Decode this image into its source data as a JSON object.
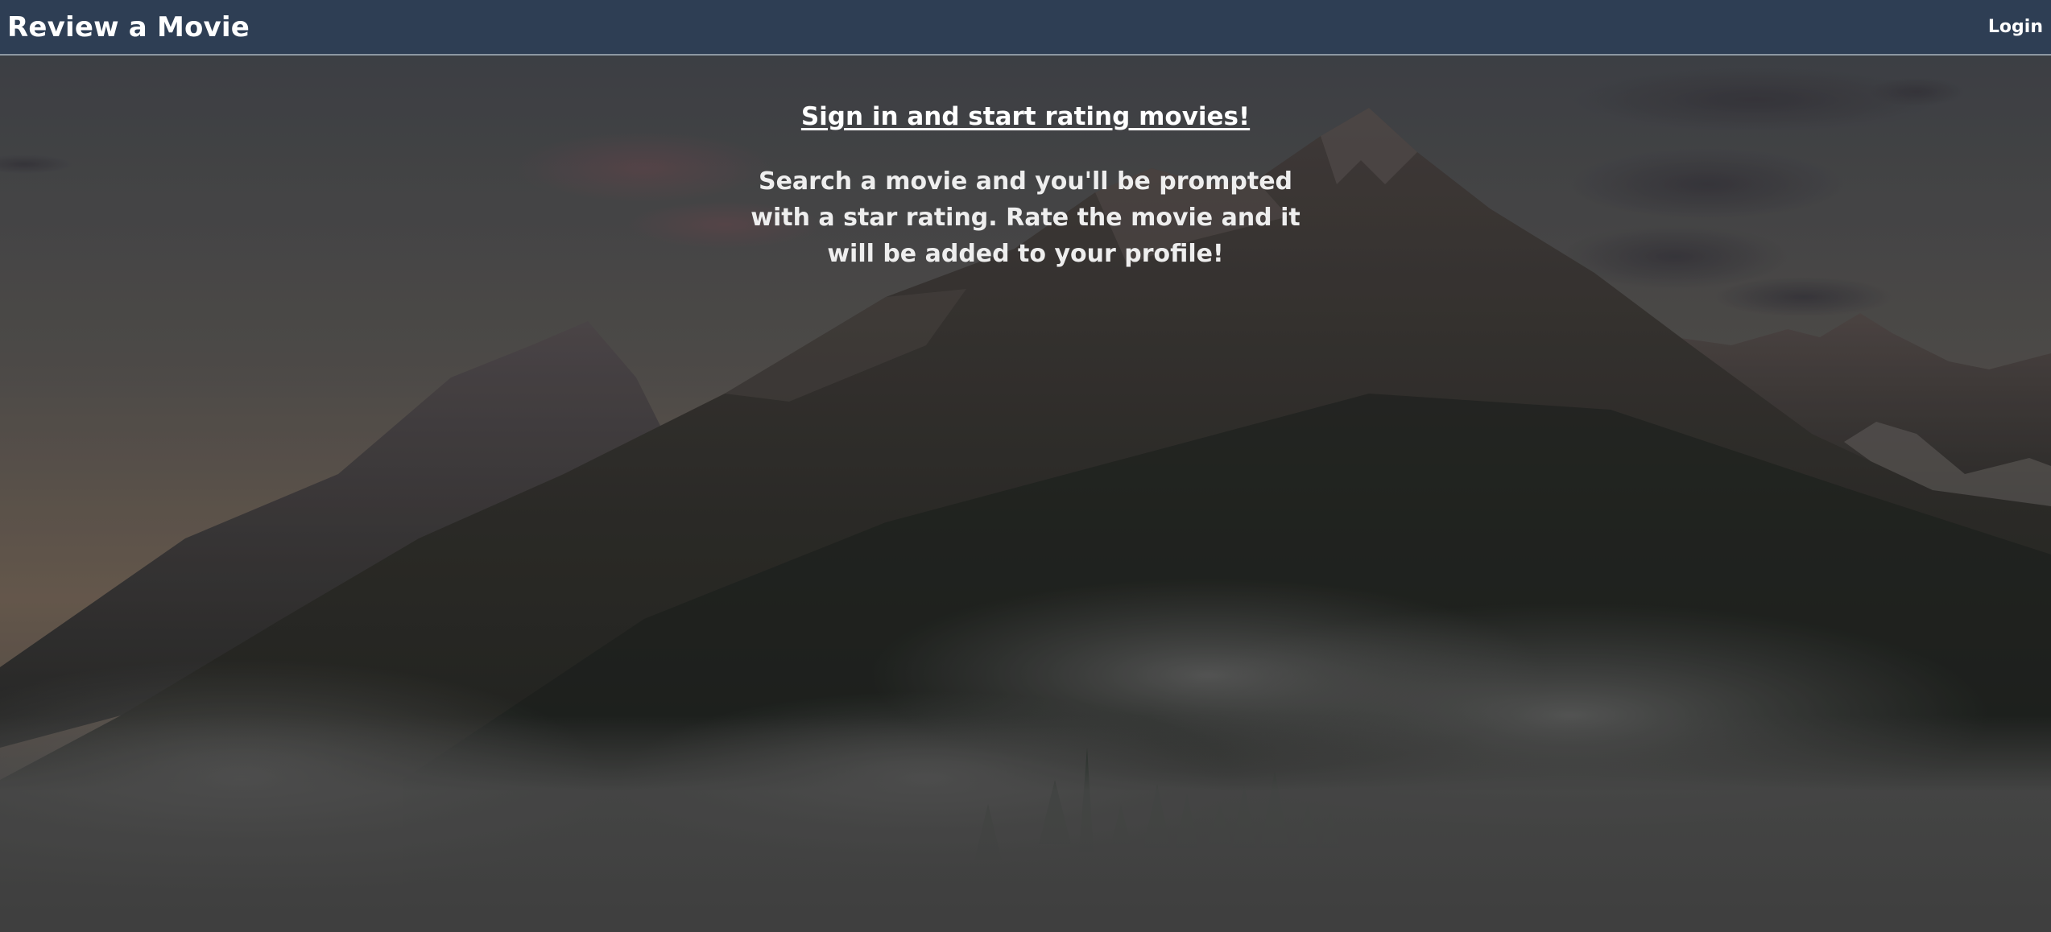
{
  "navbar": {
    "brand": "Review a Movie",
    "login_label": "Login",
    "background_color": "#2e3e54"
  },
  "hero": {
    "background_description": "mountain-landscape-with-fog",
    "cta_link": "Sign in and start rating movies!",
    "description": "Search a movie and you'll be prompted with a star rating. Rate the movie and it will be added to your profile!"
  }
}
